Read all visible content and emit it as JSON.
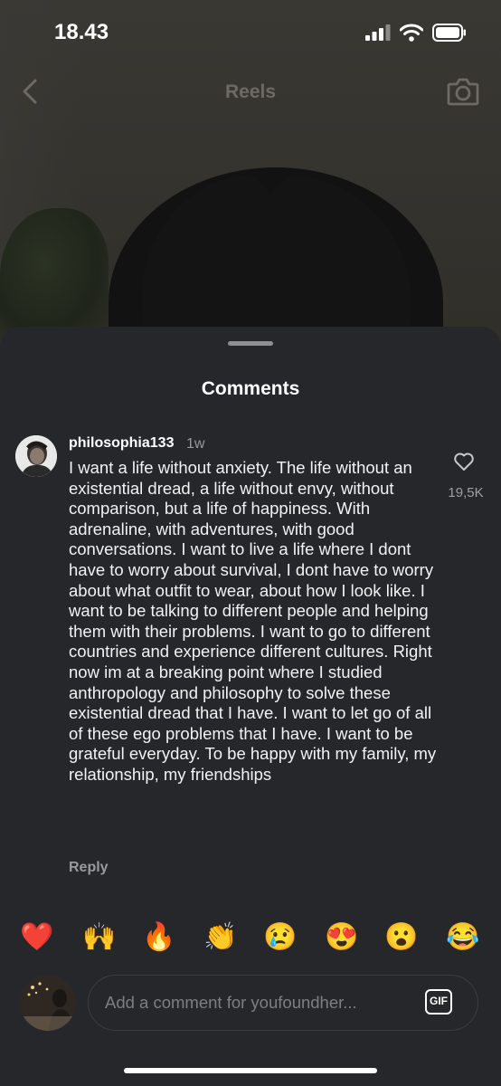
{
  "status_bar": {
    "time": "18.43"
  },
  "topbar": {
    "title": "Reels",
    "back_icon": "chevron-left-icon",
    "camera_icon": "camera-icon"
  },
  "sheet": {
    "title": "Comments"
  },
  "comment": {
    "username": "philosophia133",
    "time_ago": "1w",
    "text": "I want a life without anxiety. The life without an existential dread, a life without envy, without comparison, but a life of happiness. With adrenaline, with adventures, with good conversations. I want to live a life where I dont have to worry about survival, I dont have to worry about what outfit to wear, about how I look like. I want to be talking to different people and helping them with their problems. I want to go to different countries and experience different cultures. Right now im at a breaking point where I studied anthropology and philosophy to solve these existential dread that I have. I want to let go of all of these ego problems that I have. I want to be grateful everyday. To be happy with my family, my relationship, my friendships",
    "like_count": "19,5K",
    "reply_label": "Reply"
  },
  "emojis": [
    "❤️",
    "🙌",
    "🔥",
    "👏",
    "😢",
    "😍",
    "😮",
    "😂"
  ],
  "composer": {
    "placeholder": "Add a comment for youfoundher...",
    "gif_label": "GIF"
  }
}
